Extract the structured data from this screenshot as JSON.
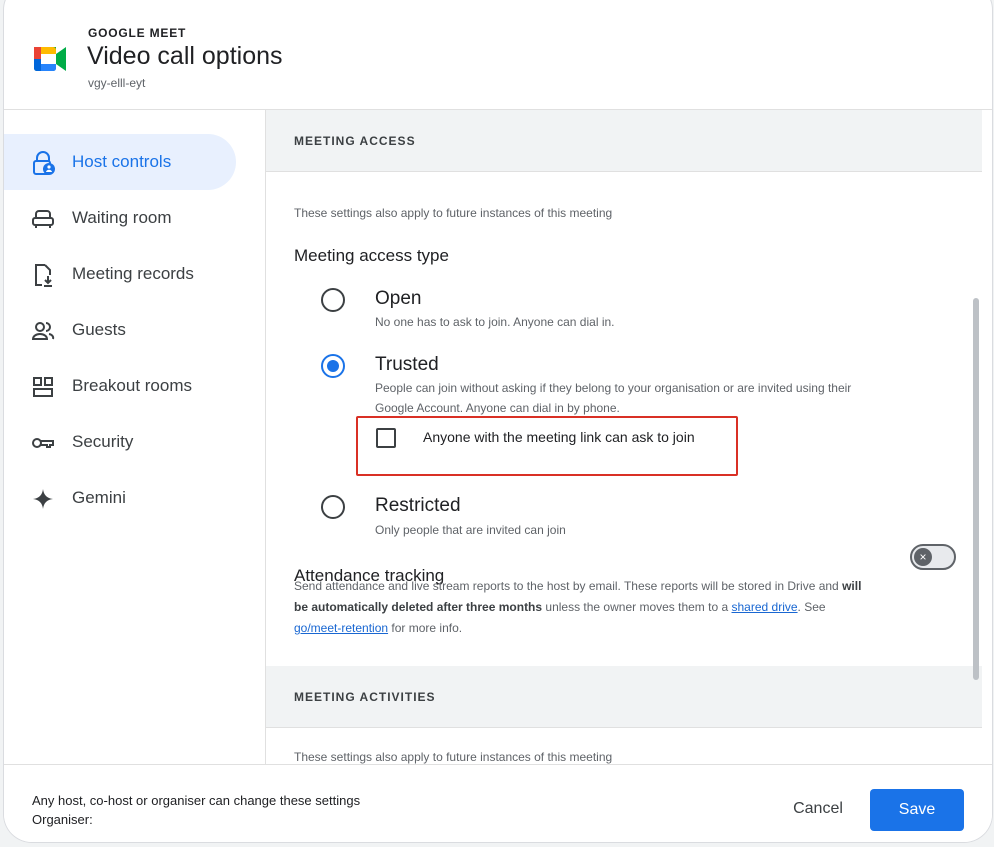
{
  "header": {
    "overline": "GOOGLE MEET",
    "title": "Video call options",
    "meeting_code": "vgy-elll-eyt"
  },
  "sidebar": {
    "items": [
      {
        "label": "Host controls",
        "icon": "lock-person-icon",
        "active": true
      },
      {
        "label": "Waiting room",
        "icon": "chair-icon"
      },
      {
        "label": "Meeting records",
        "icon": "file-download-icon"
      },
      {
        "label": "Guests",
        "icon": "people-icon"
      },
      {
        "label": "Breakout rooms",
        "icon": "grid-icon"
      },
      {
        "label": "Security",
        "icon": "key-icon"
      },
      {
        "label": "Gemini",
        "icon": "sparkle-icon"
      }
    ]
  },
  "content": {
    "meeting_access": {
      "section_title": "MEETING ACCESS",
      "note": "These settings also apply to future instances of this meeting",
      "access_type_heading": "Meeting access type",
      "options": [
        {
          "title": "Open",
          "desc": "No one has to ask to join. Anyone can dial in.",
          "selected": false
        },
        {
          "title": "Trusted",
          "desc": "People can join without asking if they belong to your organisation or are invited using their Google Account. Anyone can dial in by phone.",
          "selected": true
        },
        {
          "title": "Restricted",
          "desc": "Only people that are invited can join",
          "selected": false
        }
      ],
      "link_checkbox_label": "Anyone with the meeting link can ask to join",
      "link_checkbox_checked": false
    },
    "attendance": {
      "heading": "Attendance tracking",
      "toggle_on": false,
      "desc_1": "Send attendance and live stream reports to the host by email. These reports will be stored in Drive and ",
      "desc_bold": "will be automatically deleted after three months",
      "desc_2": " unless the owner moves them to a ",
      "link_1": "shared drive",
      "desc_3": ". See ",
      "link_2": "go/meet-retention",
      "desc_4": " for more info."
    },
    "meeting_activities": {
      "section_title": "MEETING ACTIVITIES",
      "note": "These settings also apply to future instances of this meeting"
    }
  },
  "footer": {
    "line_1": "Any host, co-host or organiser can change these settings",
    "line_2": "Organiser:",
    "cancel_label": "Cancel",
    "save_label": "Save"
  },
  "colors": {
    "accent": "#1a73e8",
    "active_bg": "#e8f0fe",
    "highlight": "#d93025"
  }
}
